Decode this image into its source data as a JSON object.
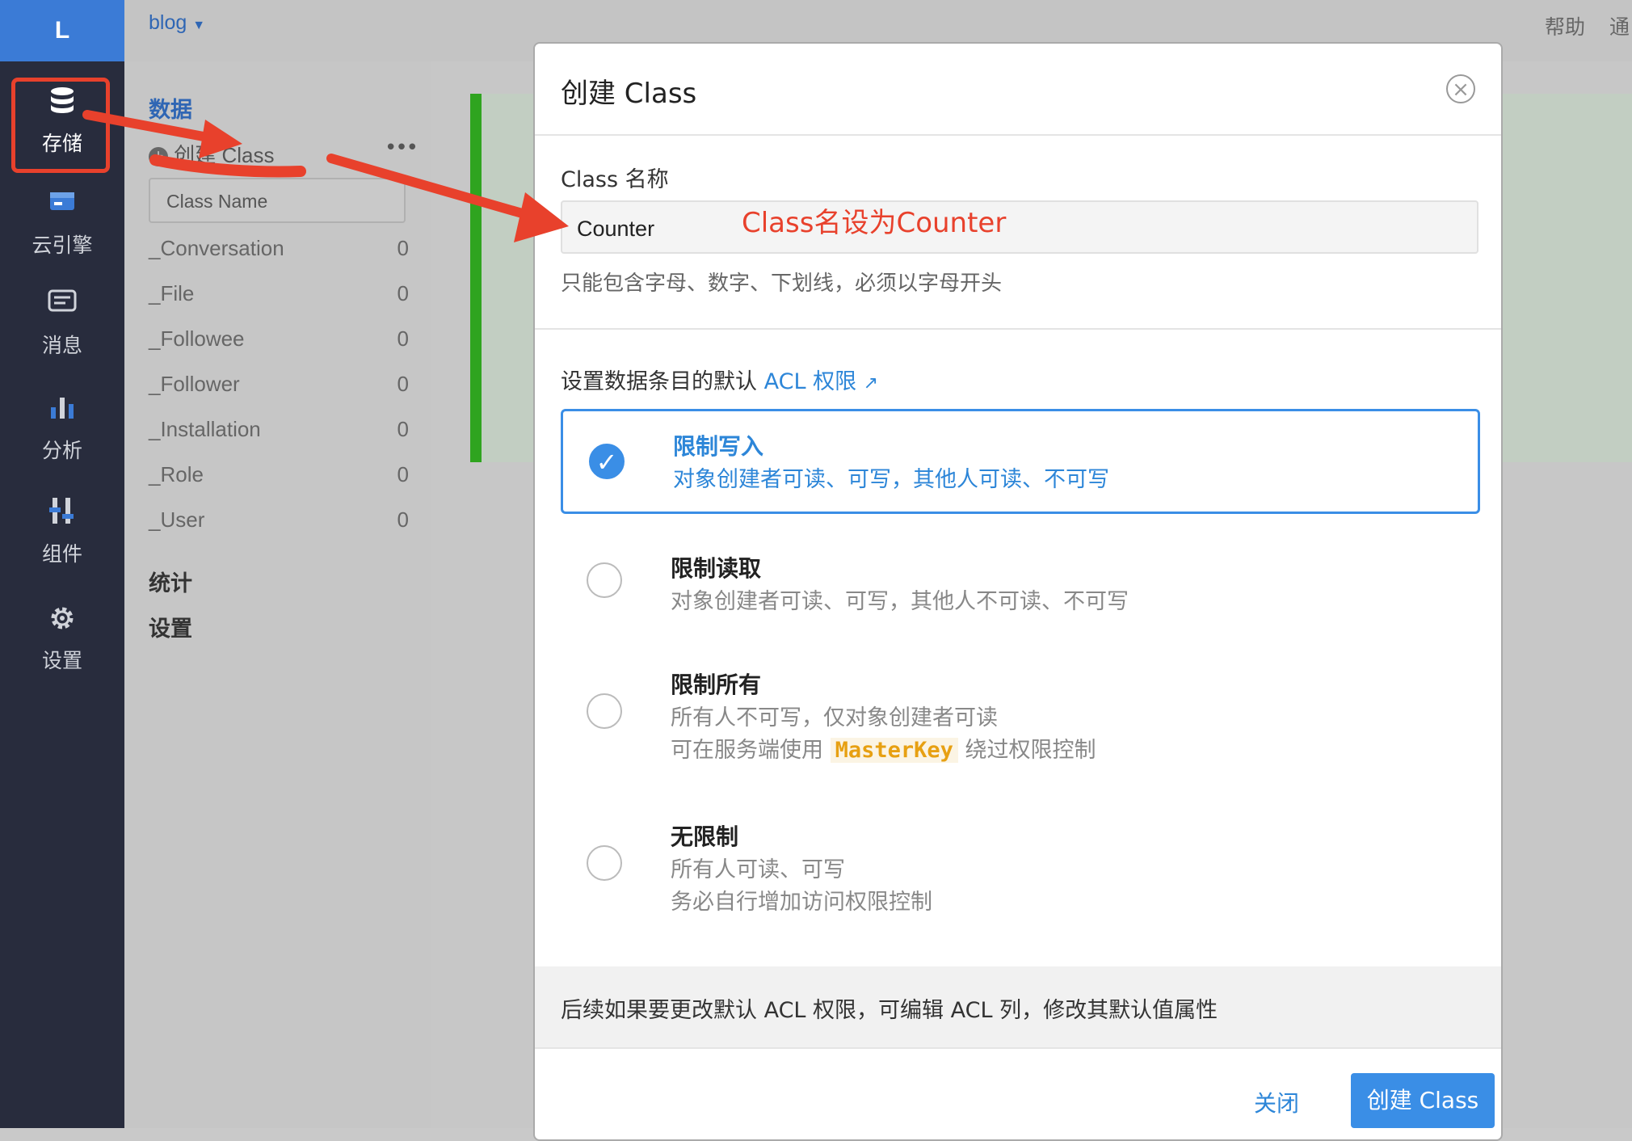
{
  "nav": {
    "logo": "L",
    "items": [
      {
        "label": "存储",
        "icon": "database-icon"
      },
      {
        "label": "云引擎",
        "icon": "cloud-engine-icon"
      },
      {
        "label": "消息",
        "icon": "message-icon"
      },
      {
        "label": "分析",
        "icon": "bar-chart-icon"
      },
      {
        "label": "组件",
        "icon": "components-icon"
      },
      {
        "label": "设置",
        "icon": "gear-icon"
      }
    ]
  },
  "topbar": {
    "app": "blog",
    "help": "帮助",
    "notify": "通"
  },
  "sidebar": {
    "section_data": "数据",
    "create_class": "创建 Class",
    "search_placeholder": "Class Name",
    "classes": [
      {
        "name": "_Conversation",
        "count": "0"
      },
      {
        "name": "_File",
        "count": "0"
      },
      {
        "name": "_Followee",
        "count": "0"
      },
      {
        "name": "_Follower",
        "count": "0"
      },
      {
        "name": "_Installation",
        "count": "0"
      },
      {
        "name": "_Role",
        "count": "0"
      },
      {
        "name": "_User",
        "count": "0"
      }
    ],
    "section_stats": "统计",
    "section_settings": "设置"
  },
  "modal": {
    "title": "创建 Class",
    "name_label": "Class 名称",
    "name_value": "Counter",
    "name_hint": "只能包含字母、数字、下划线，必须以字母开头",
    "acl_heading": "设置数据条目的默认",
    "acl_link": "ACL 权限",
    "options": [
      {
        "title": "限制写入",
        "desc1": "对象创建者可读、可写，其他人可读、不可写",
        "selected": true
      },
      {
        "title": "限制读取",
        "desc1": "对象创建者可读、可写，其他人不可读、不可写",
        "selected": false
      },
      {
        "title": "限制所有",
        "desc1": "所有人不可写，仅对象创建者可读",
        "desc2_pre": "可在服务端使用",
        "desc2_code": "MasterKey",
        "desc2_post": "绕过权限控制",
        "selected": false
      },
      {
        "title": "无限制",
        "desc1": "所有人可读、可写",
        "desc2": "务必自行增加访问权限控制",
        "selected": false
      }
    ],
    "footer_note": "后续如果要更改默认 ACL 权限，可编辑 ACL 列，修改其默认值属性",
    "close_button": "关闭",
    "create_button": "创建 Class"
  },
  "annotation": {
    "text": "Class名设为Counter",
    "color": "#e8412c"
  },
  "colors": {
    "accent": "#3a8ee6",
    "nav_bg": "#282c3d",
    "logo_bg": "#3b7bd6",
    "annotation_red": "#e8412c",
    "green": "#2fa41f"
  }
}
